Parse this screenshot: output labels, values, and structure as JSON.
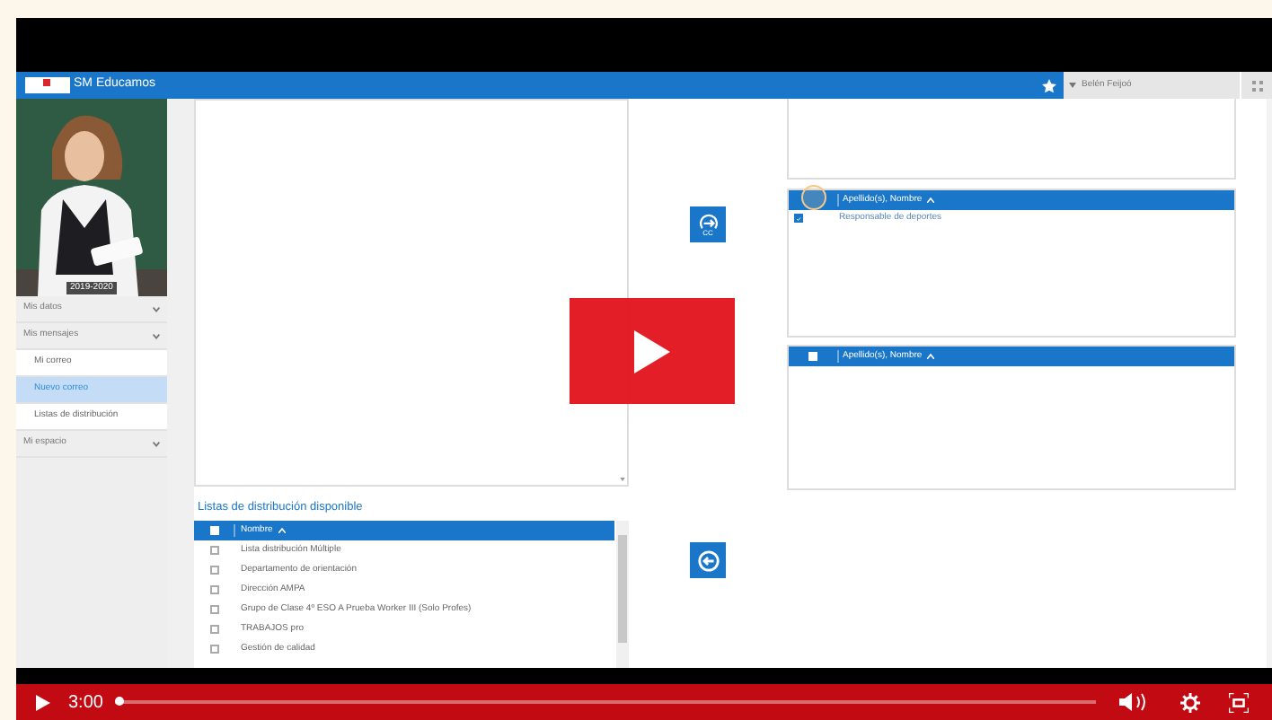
{
  "app": {
    "title": "SM Educamos",
    "user": "Belén Feijoó",
    "photo": {
      "kind": "picture",
      "caption": "2019-2020"
    }
  },
  "menu": [
    {
      "label": "Mis datos",
      "kind": "section",
      "selected": false
    },
    {
      "label": "Mis mensajes",
      "kind": "section",
      "selected": false
    },
    {
      "label": "Mi correo",
      "kind": "sub",
      "selected": false
    },
    {
      "label": "Nuevo correo",
      "kind": "sub",
      "selected": true
    },
    {
      "label": "Listas de distribución",
      "kind": "sub",
      "selected": false
    },
    {
      "label": "Mi espacio",
      "kind": "section",
      "selected": false
    }
  ],
  "recipient_tables": [
    {
      "column": "Apellido(s), Nombre",
      "rows": [
        {
          "label": "Responsable de deportes",
          "checked": true
        }
      ]
    },
    {
      "column": "Apellido(s), Nombre",
      "header_checked": false
    }
  ],
  "transfer": {
    "cc_label": "CC"
  },
  "distribution": {
    "title": "Listas de distribución disponible",
    "column": "Nombre",
    "header_checked": false,
    "rows": [
      {
        "label": "Lista distribución Múltiple",
        "checked": false
      },
      {
        "label": "Departamento de orientación",
        "checked": false
      },
      {
        "label": "Dirección AMPA",
        "checked": false
      },
      {
        "label": "Grupo de Clase 4º ESO A Prueba Worker III (Solo Profes)",
        "checked": false
      },
      {
        "label": "TRABAJOS pro",
        "checked": false
      },
      {
        "label": "Gestión de calidad",
        "checked": false
      }
    ]
  },
  "player": {
    "time": "3:00",
    "level": 0
  }
}
